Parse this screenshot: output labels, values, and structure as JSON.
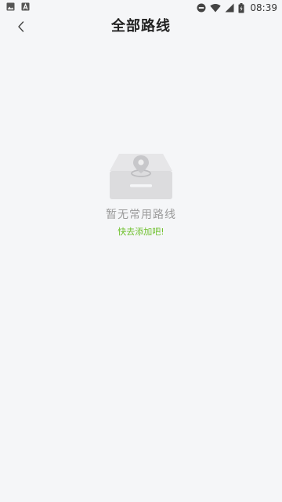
{
  "status_bar": {
    "left_icons": [
      "image-icon",
      "a-icon"
    ],
    "right_icons": [
      "do-not-disturb-icon",
      "wifi-icon",
      "signal-icon",
      "battery-icon"
    ],
    "time": "08:39"
  },
  "header": {
    "back_icon": "chevron-left-icon",
    "title": "全部路线"
  },
  "empty_state": {
    "illustration": "inbox-location-icon",
    "title": "暂无常用路线",
    "action_label": "快去添加吧!"
  },
  "colors": {
    "background": "#f5f6f8",
    "accent": "#6ec02c",
    "title_text": "#222222",
    "muted_text": "#9a9a9a"
  }
}
